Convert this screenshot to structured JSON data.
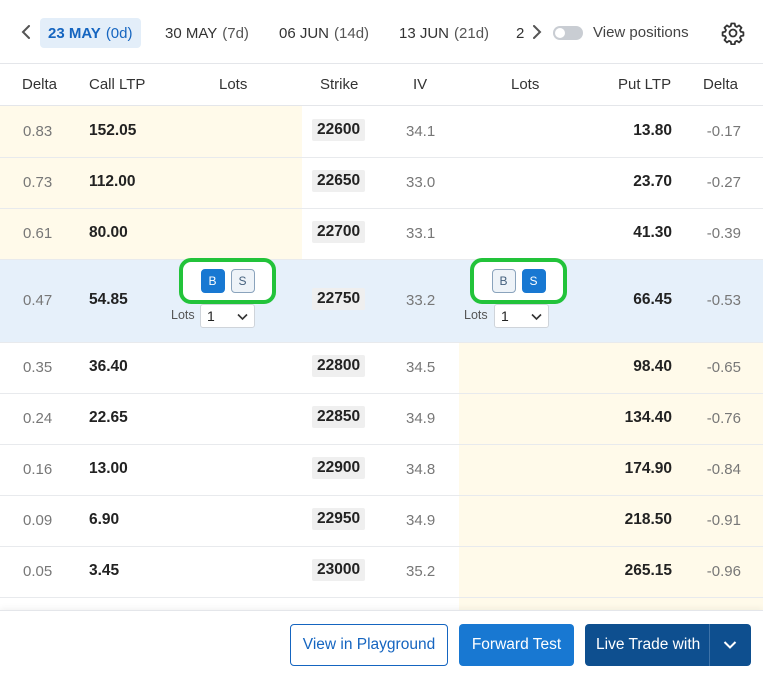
{
  "expiries": [
    {
      "date": "23 MAY",
      "days": "(0d)",
      "active": true
    },
    {
      "date": "30 MAY",
      "days": "(7d)",
      "active": false
    },
    {
      "date": "06 JUN",
      "days": "(14d)",
      "active": false
    },
    {
      "date": "13 JUN",
      "days": "(21d)",
      "active": false
    },
    {
      "date": "2",
      "days": "",
      "active": false
    }
  ],
  "view_positions_label": "View positions",
  "columns": {
    "call_delta": "Delta",
    "call_ltp": "Call LTP",
    "call_lots": "Lots",
    "strike": "Strike",
    "iv": "IV",
    "put_lots": "Lots",
    "put_ltp": "Put LTP",
    "put_delta": "Delta"
  },
  "rows": [
    {
      "call_delta": "0.83",
      "call_ltp": "152.05",
      "strike": "22600",
      "iv": "34.1",
      "put_ltp": "13.80",
      "put_delta": "-0.17"
    },
    {
      "call_delta": "0.73",
      "call_ltp": "112.00",
      "strike": "22650",
      "iv": "33.0",
      "put_ltp": "23.70",
      "put_delta": "-0.27"
    },
    {
      "call_delta": "0.61",
      "call_ltp": "80.00",
      "strike": "22700",
      "iv": "33.1",
      "put_ltp": "41.30",
      "put_delta": "-0.39"
    },
    {
      "call_delta": "0.47",
      "call_ltp": "54.85",
      "strike": "22750",
      "iv": "33.2",
      "put_ltp": "66.45",
      "put_delta": "-0.53"
    },
    {
      "call_delta": "0.35",
      "call_ltp": "36.40",
      "strike": "22800",
      "iv": "34.5",
      "put_ltp": "98.40",
      "put_delta": "-0.65"
    },
    {
      "call_delta": "0.24",
      "call_ltp": "22.65",
      "strike": "22850",
      "iv": "34.9",
      "put_ltp": "134.40",
      "put_delta": "-0.76"
    },
    {
      "call_delta": "0.16",
      "call_ltp": "13.00",
      "strike": "22900",
      "iv": "34.8",
      "put_ltp": "174.90",
      "put_delta": "-0.84"
    },
    {
      "call_delta": "0.09",
      "call_ltp": "6.90",
      "strike": "22950",
      "iv": "34.9",
      "put_ltp": "218.50",
      "put_delta": "-0.91"
    },
    {
      "call_delta": "0.05",
      "call_ltp": "3.45",
      "strike": "23000",
      "iv": "35.2",
      "put_ltp": "265.15",
      "put_delta": "-0.96"
    }
  ],
  "atm": {
    "buy_label": "B",
    "sell_label": "S",
    "lots_label": "Lots",
    "call_lots_value": "1",
    "put_lots_value": "1",
    "call_selected": "B",
    "put_selected": "S"
  },
  "footer": {
    "playground_label": "View in Playground",
    "forward_test_label": "Forward Test",
    "live_trade_label": "Live Trade with"
  },
  "colors": {
    "accent": "#1878d2",
    "dark_accent": "#0e4f8f",
    "highlight": "#22c33a",
    "itm_bg": "#fffaea",
    "atm_bg": "#e6f0fa"
  }
}
